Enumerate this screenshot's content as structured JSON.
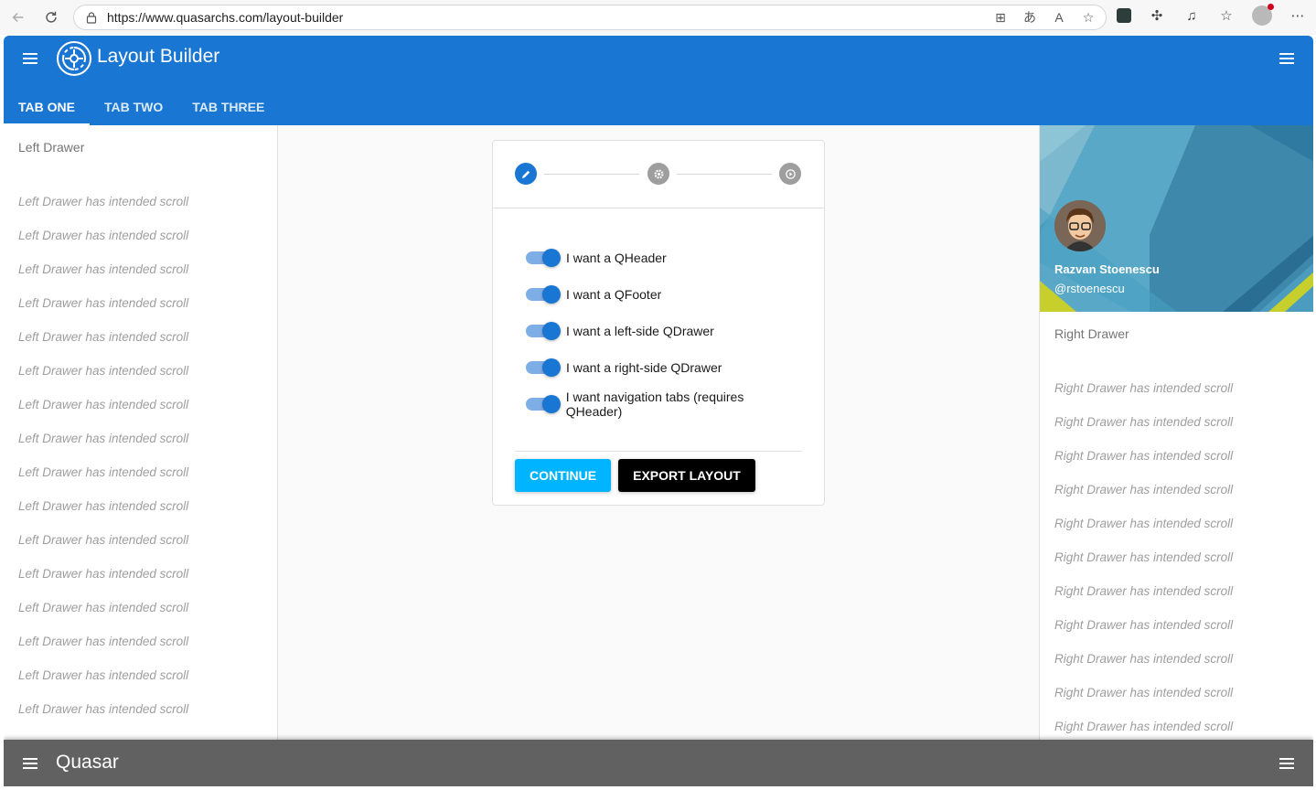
{
  "browser": {
    "url": "https://www.quasarchs.com/layout-builder"
  },
  "header": {
    "title": "Layout Builder",
    "tabs": [
      {
        "label": "TAB ONE",
        "active": true
      },
      {
        "label": "TAB TWO",
        "active": false
      },
      {
        "label": "TAB THREE",
        "active": false
      }
    ]
  },
  "left_drawer": {
    "title": "Left Drawer",
    "item_text": "Left Drawer has intended scroll",
    "items": [
      "Left Drawer has intended scroll",
      "Left Drawer has intended scroll",
      "Left Drawer has intended scroll",
      "Left Drawer has intended scroll",
      "Left Drawer has intended scroll",
      "Left Drawer has intended scroll",
      "Left Drawer has intended scroll",
      "Left Drawer has intended scroll",
      "Left Drawer has intended scroll",
      "Left Drawer has intended scroll",
      "Left Drawer has intended scroll",
      "Left Drawer has intended scroll",
      "Left Drawer has intended scroll",
      "Left Drawer has intended scroll",
      "Left Drawer has intended scroll",
      "Left Drawer has intended scroll"
    ]
  },
  "right_drawer": {
    "profile_name": "Razvan Stoenescu",
    "profile_handle": "@rstoenescu",
    "title": "Right Drawer",
    "items": [
      "Right Drawer has intended scroll",
      "Right Drawer has intended scroll",
      "Right Drawer has intended scroll",
      "Right Drawer has intended scroll",
      "Right Drawer has intended scroll",
      "Right Drawer has intended scroll",
      "Right Drawer has intended scroll",
      "Right Drawer has intended scroll",
      "Right Drawer has intended scroll",
      "Right Drawer has intended scroll",
      "Right Drawer has intended scroll"
    ]
  },
  "stepper": {
    "steps": [
      {
        "icon": "pencil-icon",
        "state": "active",
        "color": "#1976d2"
      },
      {
        "icon": "gear-icon",
        "state": "inactive",
        "color": "#9e9e9e"
      },
      {
        "icon": "play-icon",
        "state": "inactive",
        "color": "#9e9e9e"
      }
    ],
    "toggles": [
      {
        "label": "I want a QHeader",
        "on": true
      },
      {
        "label": "I want a QFooter",
        "on": true
      },
      {
        "label": "I want a left-side QDrawer",
        "on": true
      },
      {
        "label": "I want a right-side QDrawer",
        "on": true
      },
      {
        "label": "I want navigation tabs (requires QHeader)",
        "on": true
      }
    ],
    "continue_label": "CONTINUE",
    "export_label": "EXPORT LAYOUT"
  },
  "footer": {
    "title": "Quasar"
  },
  "colors": {
    "primary": "#1976d2",
    "footer": "#616161",
    "continue": "#00b4ff"
  }
}
